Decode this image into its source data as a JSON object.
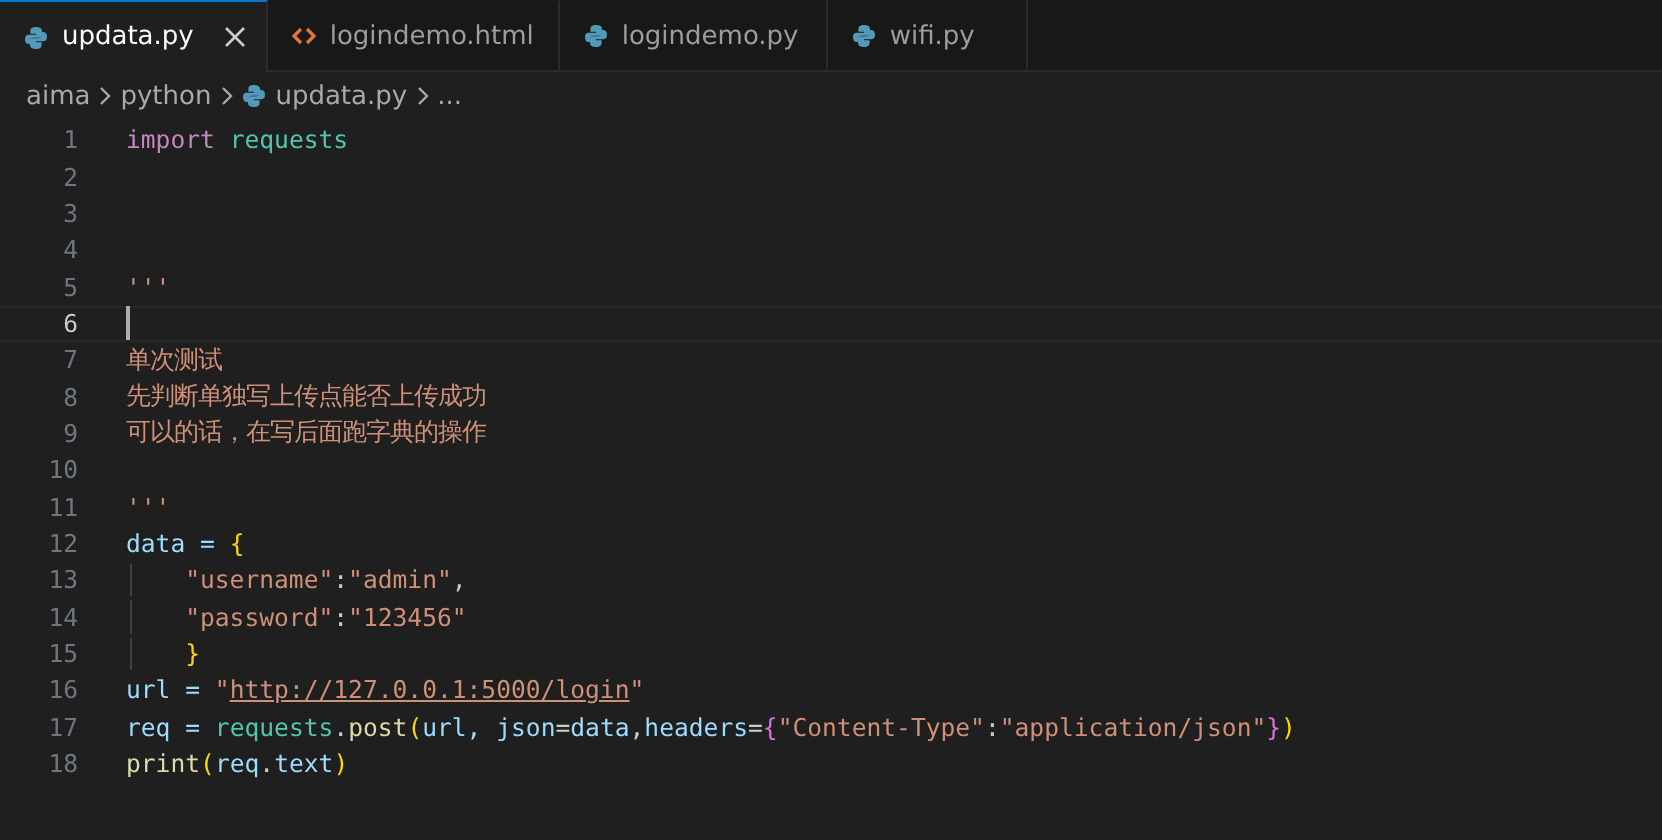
{
  "tabs": [
    {
      "label": "updata.py",
      "kind": "python",
      "selected": true,
      "closable": true
    },
    {
      "label": "logindemo.html",
      "kind": "html",
      "selected": false,
      "closable": false
    },
    {
      "label": "logindemo.py",
      "kind": "python",
      "selected": false,
      "closable": false
    },
    {
      "label": "wifi.py",
      "kind": "python",
      "selected": false,
      "closable": false
    }
  ],
  "breadcrumb": [
    {
      "label": "aima",
      "kind": "folder"
    },
    {
      "label": "python",
      "kind": "folder"
    },
    {
      "label": "updata.py",
      "kind": "python"
    },
    {
      "label": "...",
      "kind": "more"
    }
  ],
  "lines": [
    {
      "number": "1",
      "current": false,
      "tokens": [
        {
          "text": "import ",
          "kind": "keyword"
        },
        {
          "text": "requests",
          "kind": "module"
        }
      ]
    },
    {
      "number": "2",
      "current": false
    },
    {
      "number": "3",
      "current": false
    },
    {
      "number": "4",
      "current": false
    },
    {
      "number": "5",
      "current": false,
      "tokens": [
        {
          "text": "'''",
          "kind": "string"
        }
      ]
    },
    {
      "number": "6",
      "current": true
    },
    {
      "number": "7",
      "current": false,
      "tokens": [
        {
          "text": "单次测试",
          "kind": "string"
        }
      ]
    },
    {
      "number": "8",
      "current": false,
      "tokens": [
        {
          "text": "先判断单独写上传点能否上传成功",
          "kind": "string"
        }
      ]
    },
    {
      "number": "9",
      "current": false,
      "tokens": [
        {
          "text": "可以的话，在写后面跑字典的操作",
          "kind": "string"
        }
      ]
    },
    {
      "number": "10",
      "current": false
    },
    {
      "number": "11",
      "current": false,
      "tokens": [
        {
          "text": "'''",
          "kind": "string"
        }
      ]
    },
    {
      "number": "12",
      "current": false,
      "tokens": [
        {
          "text": "data = ",
          "kind": "variable"
        },
        {
          "text": "{",
          "kind": "bracket"
        }
      ]
    },
    {
      "number": "13",
      "current": false,
      "guide": true,
      "tokens": [
        {
          "text": "\"username\"",
          "kind": "string"
        },
        {
          "text": ":",
          "kind": "plain"
        },
        {
          "text": "\"admin\"",
          "kind": "string"
        },
        {
          "text": ",",
          "kind": "plain"
        }
      ]
    },
    {
      "number": "14",
      "current": false,
      "guide": true,
      "tokens": [
        {
          "text": "\"password\"",
          "kind": "string"
        },
        {
          "text": ":",
          "kind": "plain"
        },
        {
          "text": "\"123456\"",
          "kind": "string"
        }
      ]
    },
    {
      "number": "15",
      "current": false,
      "guide": true,
      "tokens": [
        {
          "text": "}",
          "kind": "bracket"
        }
      ]
    },
    {
      "number": "16",
      "current": false,
      "tokens": [
        {
          "text": "url = ",
          "kind": "variable"
        },
        {
          "text": "\"",
          "kind": "string"
        },
        {
          "text": "http://127.0.0.1:5000/login",
          "kind": "link"
        },
        {
          "text": "\"",
          "kind": "string"
        }
      ]
    },
    {
      "number": "17",
      "current": false,
      "tokens": [
        {
          "text": "req = ",
          "kind": "variable"
        },
        {
          "text": "requests",
          "kind": "module"
        },
        {
          "text": ".",
          "kind": "plain"
        },
        {
          "text": "post",
          "kind": "function"
        },
        {
          "text": "(",
          "kind": "bracket"
        },
        {
          "text": "url, json",
          "kind": "variable"
        },
        {
          "text": "=",
          "kind": "plain"
        },
        {
          "text": "data",
          "kind": "variable"
        },
        {
          "text": ",",
          "kind": "plain"
        },
        {
          "text": "headers",
          "kind": "variable"
        },
        {
          "text": "=",
          "kind": "plain"
        },
        {
          "text": "{",
          "kind": "bracket2"
        },
        {
          "text": "\"Content-Type\"",
          "kind": "string"
        },
        {
          "text": ":",
          "kind": "plain"
        },
        {
          "text": "\"application/json\"",
          "kind": "string"
        },
        {
          "text": "}",
          "kind": "bracket2"
        },
        {
          "text": ")",
          "kind": "bracket"
        }
      ]
    },
    {
      "number": "18",
      "current": false,
      "tokens": [
        {
          "text": "print",
          "kind": "function"
        },
        {
          "text": "(",
          "kind": "bracket"
        },
        {
          "text": "req",
          "kind": "variable"
        },
        {
          "text": ".",
          "kind": "plain"
        },
        {
          "text": "text",
          "kind": "variable"
        },
        {
          "text": ")",
          "kind": "bracket"
        }
      ]
    }
  ]
}
